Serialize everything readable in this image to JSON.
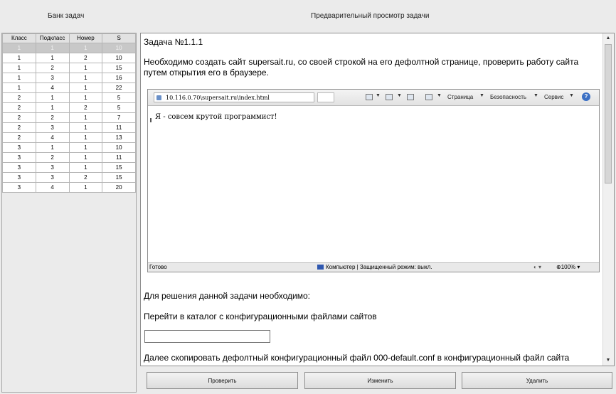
{
  "headers": {
    "bank_title": "Банк задач",
    "preview_title": "Предварительный просмотр задачи"
  },
  "bank_table": {
    "columns": [
      "Класс",
      "Подкласс",
      "Номер",
      "S"
    ],
    "selected_row": 0,
    "rows": [
      [
        "1",
        "1",
        "1",
        "10"
      ],
      [
        "1",
        "1",
        "2",
        "10"
      ],
      [
        "1",
        "2",
        "1",
        "15"
      ],
      [
        "1",
        "3",
        "1",
        "16"
      ],
      [
        "1",
        "4",
        "1",
        "22"
      ],
      [
        "2",
        "1",
        "1",
        "5"
      ],
      [
        "2",
        "1",
        "2",
        "5"
      ],
      [
        "2",
        "2",
        "1",
        "7"
      ],
      [
        "2",
        "3",
        "1",
        "11"
      ],
      [
        "2",
        "4",
        "1",
        "13"
      ],
      [
        "3",
        "1",
        "1",
        "10"
      ],
      [
        "3",
        "2",
        "1",
        "11"
      ],
      [
        "3",
        "3",
        "1",
        "15"
      ],
      [
        "3",
        "3",
        "2",
        "15"
      ],
      [
        "3",
        "4",
        "1",
        "20"
      ]
    ]
  },
  "task": {
    "title": "Задача №1.1.1",
    "description": "Необходимо создать сайт supersait.ru, со своей строкой на его дефолтной странице, проверить работу сайта путем открытия его в браузере.",
    "need_label": "Для решения данной задачи необходимо:",
    "step1": "Перейти в каталог с конфигурационными файлами сайтов",
    "answer_value": "",
    "step2": "Далее скопировать дефолтный конфигурационный файл 000-default.conf в конфигурационный файл сайта"
  },
  "browser": {
    "address": "10.116.0.70\\supersait.ru\\index.html",
    "menu_page": "Страница",
    "menu_security": "Безопасность",
    "menu_service": "Сервис",
    "page_text": "Я - совсем крутой программист!",
    "status_ready": "Готово",
    "status_zone": "Компьютер | Защищенный режим: выкл.",
    "status_zoom": "100%"
  },
  "buttons": {
    "check": "Проверить",
    "edit": "Изменить",
    "delete": "Удалить"
  }
}
